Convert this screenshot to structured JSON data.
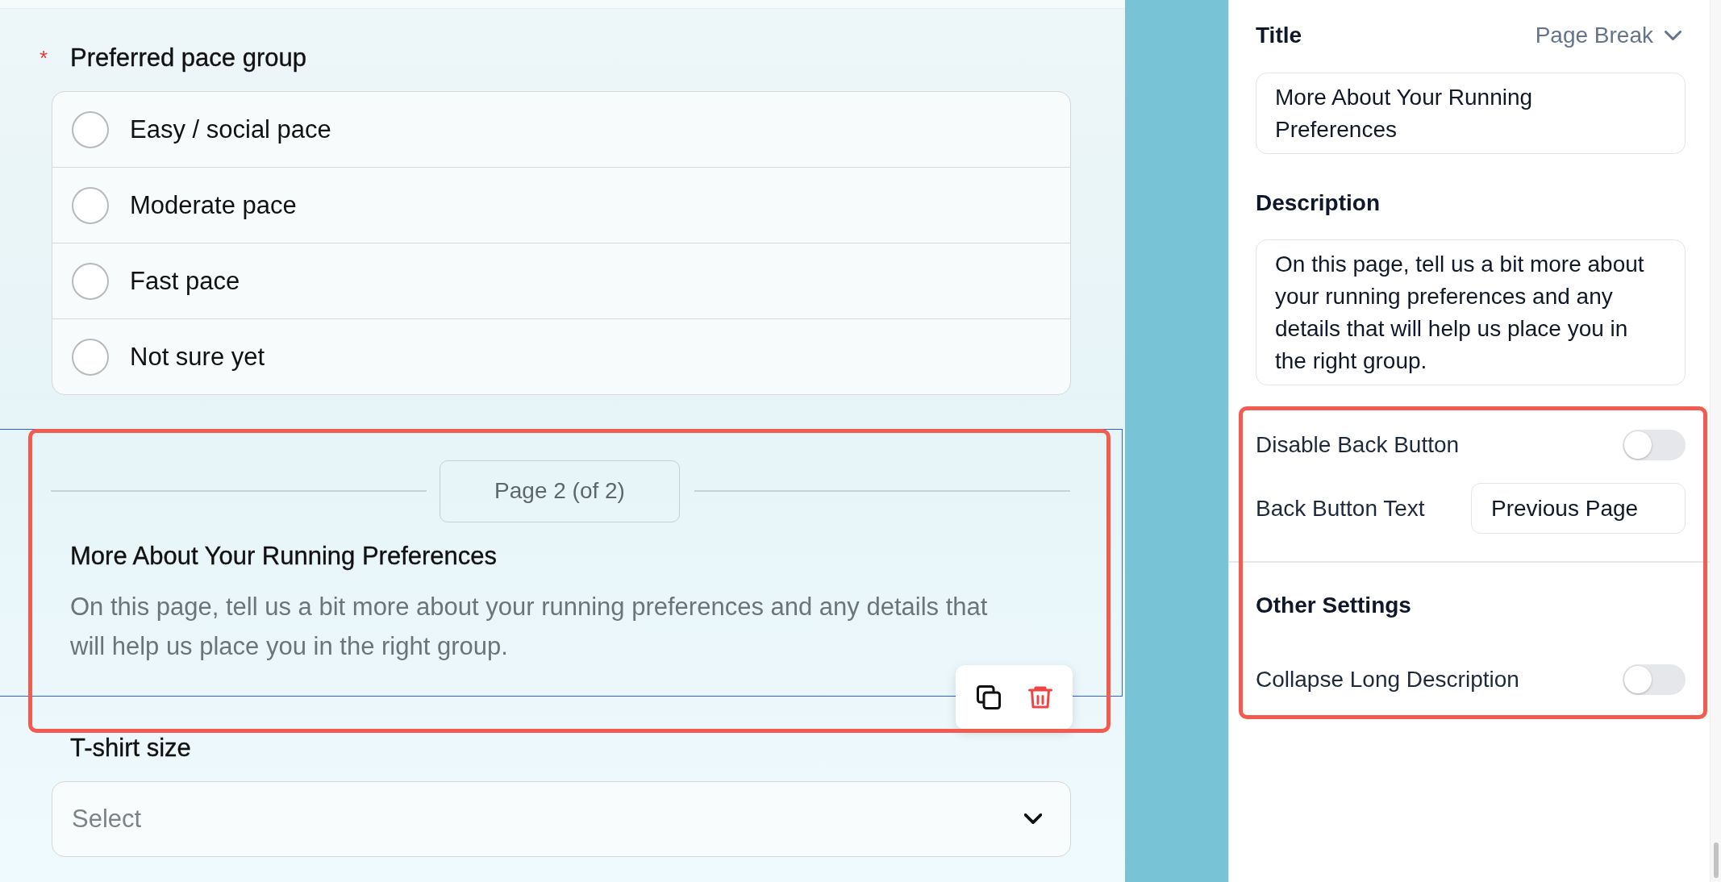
{
  "form": {
    "question": {
      "required_mark": "*",
      "label": "Preferred pace group",
      "options": [
        {
          "label": "Easy / social pace",
          "selected": false
        },
        {
          "label": "Moderate pace",
          "selected": false
        },
        {
          "label": "Fast pace",
          "selected": false
        },
        {
          "label": "Not sure yet",
          "selected": false
        }
      ]
    },
    "page_break": {
      "selected": true,
      "highlighted": true,
      "page_label": "Page 2 (of 2)",
      "title": "More About Your Running Preferences",
      "description": "On this page, tell us a bit more about your running preferences and any details that will help us place you in the right group."
    },
    "dropdown_question": {
      "label": "T-shirt size",
      "placeholder": "Select"
    }
  },
  "settings_panel": {
    "title_label": "Title",
    "element_type": "Page Break",
    "title_value": "More About Your Running Preferences",
    "description_label": "Description",
    "description_value": "On this page, tell us a bit more about your running preferences and any details that will help us place you in the right group.",
    "options_group": {
      "highlighted": true,
      "disable_back_button": {
        "label": "Disable Back Button",
        "on": false
      },
      "back_button_text": {
        "label": "Back Button Text",
        "value": "Previous Page"
      },
      "other_settings_heading": "Other Settings",
      "collapse_long_description": {
        "label": "Collapse Long Description",
        "on": false
      }
    }
  }
}
